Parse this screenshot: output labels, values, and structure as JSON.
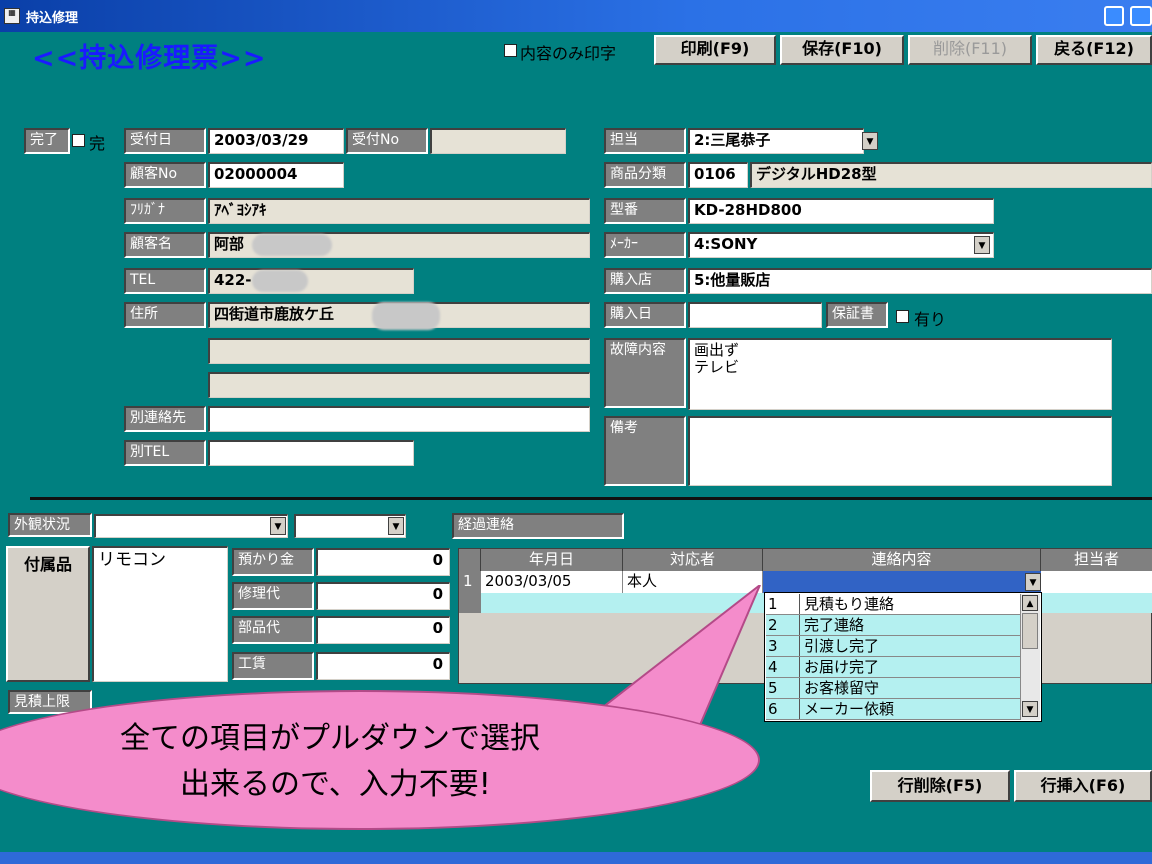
{
  "window": {
    "title": "持込修理"
  },
  "header": {
    "title": "<<持込修理票>>",
    "print_content_only": "内容のみ印字",
    "buttons": {
      "print": "印刷(F9)",
      "save": "保存(F10)",
      "delete": "削除(F11)",
      "back": "戻る(F12)"
    }
  },
  "left_form": {
    "complete_label": "完了",
    "complete_checkbox": "完",
    "received_date_label": "受付日",
    "received_date": "2003/03/29",
    "received_no_label": "受付No",
    "received_no": "",
    "customer_no_label": "顧客No",
    "customer_no": "02000004",
    "furigana_label": "ﾌﾘｶﾞﾅ",
    "furigana": "ｱﾍﾞﾖｼｱｷ",
    "customer_name_label": "顧客名",
    "customer_name": "阿部",
    "tel_label": "TEL",
    "tel": "422-",
    "address_label": "住所",
    "address": "四街道市鹿放ケ丘",
    "alt_contact_label": "別連絡先",
    "alt_tel_label": "別TEL"
  },
  "right_form": {
    "staff_label": "担当",
    "staff": "2:三尾恭子",
    "category_label": "商品分類",
    "category_code": "0106",
    "category_name": "デジタルHD28型",
    "model_label": "型番",
    "model": "KD-28HD800",
    "maker_label": "ﾒｰｶｰ",
    "maker": "4:SONY",
    "store_label": "購入店",
    "store": "5:他量販店",
    "purchase_date_label": "購入日",
    "purchase_date": "",
    "warranty_label": "保証書",
    "warranty_check": "有り",
    "fault_label": "故障内容",
    "fault_line1": "画出ず",
    "fault_line2": "テレビ",
    "notes_label": "備考"
  },
  "lower": {
    "appearance_label": "外観状況",
    "progress_label": "経過連絡",
    "accessories_label": "付属品",
    "accessories": "リモコン",
    "deposit_label": "預かり金",
    "deposit": "0",
    "repair_fee_label": "修理代",
    "repair_fee": "0",
    "parts_fee_label": "部品代",
    "parts_fee": "0",
    "labor_label": "工賃",
    "labor": "0",
    "estimate_limit_label": "見積上限",
    "delete_row": "行削除(F5)",
    "insert_row": "行挿入(F6)"
  },
  "grid": {
    "headers": [
      "年月日",
      "対応者",
      "連絡内容",
      "担当者"
    ],
    "row_number": "1",
    "row": {
      "date": "2003/03/05",
      "person": "本人",
      "content": "",
      "staff": ""
    }
  },
  "dropdown_options": [
    {
      "num": "1",
      "label": "見積もり連絡"
    },
    {
      "num": "2",
      "label": "完了連絡"
    },
    {
      "num": "3",
      "label": "引渡し完了"
    },
    {
      "num": "4",
      "label": "お届け完了"
    },
    {
      "num": "5",
      "label": "お客様留守"
    },
    {
      "num": "6",
      "label": "メーカー依頼"
    }
  ],
  "callout": {
    "line1": "全ての項目がプルダウンで選択",
    "line2": "出来るので、入力不要!"
  }
}
